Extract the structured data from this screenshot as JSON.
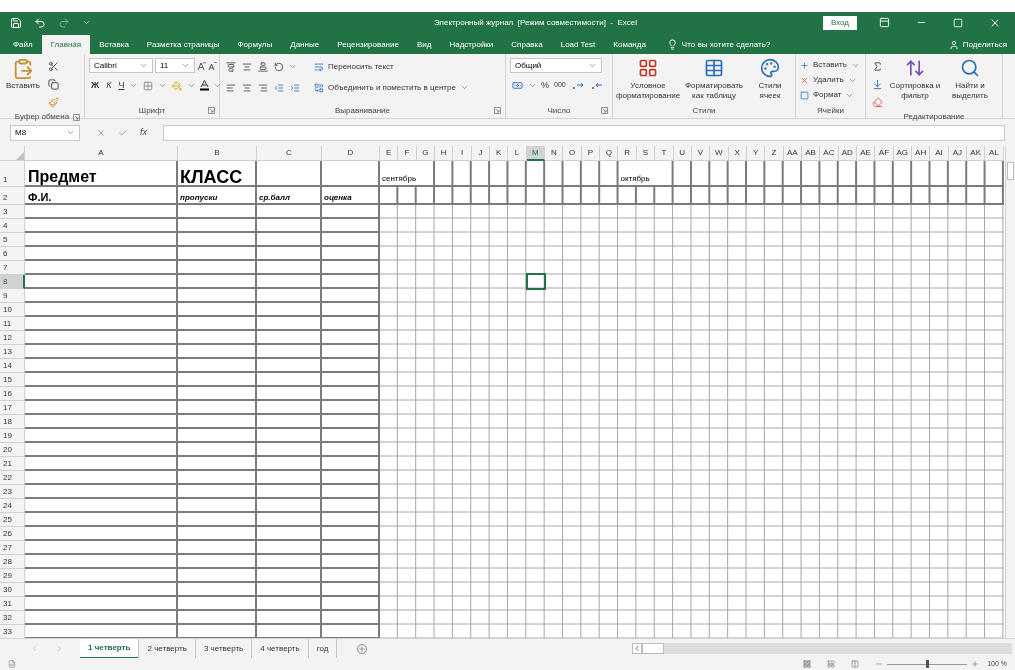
{
  "window": {
    "title": "Электронный журнал  [Режим совместимости]  -  Excel",
    "signin": "Вход"
  },
  "tabs": [
    {
      "label": "Файл",
      "selected": false
    },
    {
      "label": "Главная",
      "selected": true
    },
    {
      "label": "Вставка",
      "selected": false
    },
    {
      "label": "Разметка страницы",
      "selected": false
    },
    {
      "label": "Формулы",
      "selected": false
    },
    {
      "label": "Данные",
      "selected": false
    },
    {
      "label": "Рецензирование",
      "selected": false
    },
    {
      "label": "Вид",
      "selected": false
    },
    {
      "label": "Надстройки",
      "selected": false
    },
    {
      "label": "Справка",
      "selected": false
    },
    {
      "label": "Load Test",
      "selected": false
    },
    {
      "label": "Команда",
      "selected": false
    }
  ],
  "tell_me": {
    "placeholder": "Что вы хотите сделать?"
  },
  "share": "Поделиться",
  "ribbon": {
    "clipboard": {
      "label": "Буфер обмена",
      "paste": "Вставить"
    },
    "font": {
      "label": "Шрифт",
      "family": "Calibri",
      "size": "11",
      "bold": "Ж",
      "italic": "К",
      "underline": "Ч"
    },
    "alignment": {
      "label": "Выравнивание",
      "wrap": "Переносить текст",
      "merge": "Объединить и поместить в центре"
    },
    "number": {
      "label": "Число",
      "format": "Общий",
      "percent": "%",
      "thousands": "000"
    },
    "styles": {
      "label": "Стили",
      "conditional": "Условное форматирование",
      "as_table": "Форматировать как таблицу",
      "cell_styles": "Стили ячеек"
    },
    "cells": {
      "label": "Ячейки",
      "insert": "Вставить",
      "delete": "Удалить",
      "format": "Формат"
    },
    "editing": {
      "label": "Редактирование",
      "sort": "Сортировка и фильтр",
      "find": "Найти и выделить"
    }
  },
  "formula_bar": {
    "name_box": "M8",
    "fx": "fx"
  },
  "sheet": {
    "columns": [
      {
        "label": "A",
        "selected": false
      },
      {
        "label": "B",
        "selected": false
      },
      {
        "label": "C",
        "selected": false
      },
      {
        "label": "D",
        "selected": false
      },
      {
        "label": "E",
        "selected": false
      },
      {
        "label": "F",
        "selected": false
      },
      {
        "label": "G",
        "selected": false
      },
      {
        "label": "H",
        "selected": false
      },
      {
        "label": "I",
        "selected": false
      },
      {
        "label": "J",
        "selected": false
      },
      {
        "label": "K",
        "selected": false
      },
      {
        "label": "L",
        "selected": false
      },
      {
        "label": "M",
        "selected": true
      },
      {
        "label": "N",
        "selected": false
      },
      {
        "label": "O",
        "selected": false
      },
      {
        "label": "P",
        "selected": false
      },
      {
        "label": "Q",
        "selected": false
      },
      {
        "label": "R",
        "selected": false
      },
      {
        "label": "S",
        "selected": false
      },
      {
        "label": "T",
        "selected": false
      },
      {
        "label": "U",
        "selected": false
      },
      {
        "label": "V",
        "selected": false
      },
      {
        "label": "W",
        "selected": false
      },
      {
        "label": "X",
        "selected": false
      },
      {
        "label": "Y",
        "selected": false
      },
      {
        "label": "Z",
        "selected": false
      },
      {
        "label": "AA",
        "selected": false
      },
      {
        "label": "AB",
        "selected": false
      },
      {
        "label": "AC",
        "selected": false
      },
      {
        "label": "AD",
        "selected": false
      },
      {
        "label": "AE",
        "selected": false
      },
      {
        "label": "AF",
        "selected": false
      },
      {
        "label": "AG",
        "selected": false
      },
      {
        "label": "AH",
        "selected": false
      },
      {
        "label": "AI",
        "selected": false
      },
      {
        "label": "AJ",
        "selected": false
      },
      {
        "label": "AK",
        "selected": false
      },
      {
        "label": "AL",
        "selected": false
      }
    ],
    "rows": [
      {
        "label": "1",
        "selected": false
      },
      {
        "label": "2",
        "selected": false
      },
      {
        "label": "3",
        "selected": false
      },
      {
        "label": "4",
        "selected": false
      },
      {
        "label": "5",
        "selected": false
      },
      {
        "label": "6",
        "selected": false
      },
      {
        "label": "7",
        "selected": false
      },
      {
        "label": "8",
        "selected": true
      },
      {
        "label": "9",
        "selected": false
      },
      {
        "label": "10",
        "selected": false
      },
      {
        "label": "11",
        "selected": false
      },
      {
        "label": "12",
        "selected": false
      },
      {
        "label": "13",
        "selected": false
      },
      {
        "label": "14",
        "selected": false
      },
      {
        "label": "15",
        "selected": false
      },
      {
        "label": "16",
        "selected": false
      },
      {
        "label": "17",
        "selected": false
      },
      {
        "label": "18",
        "selected": false
      },
      {
        "label": "19",
        "selected": false
      },
      {
        "label": "20",
        "selected": false
      },
      {
        "label": "21",
        "selected": false
      },
      {
        "label": "22",
        "selected": false
      },
      {
        "label": "23",
        "selected": false
      },
      {
        "label": "24",
        "selected": false
      },
      {
        "label": "25",
        "selected": false
      },
      {
        "label": "26",
        "selected": false
      },
      {
        "label": "27",
        "selected": false
      },
      {
        "label": "28",
        "selected": false
      },
      {
        "label": "29",
        "selected": false
      },
      {
        "label": "30",
        "selected": false
      },
      {
        "label": "31",
        "selected": false
      },
      {
        "label": "32",
        "selected": false
      },
      {
        "label": "33",
        "selected": false
      }
    ],
    "row_1": {
      "subject": "Предмет",
      "class": "КЛАСС",
      "months": [
        "сентябрь",
        "октябрь"
      ]
    },
    "row_2": {
      "name": "Ф.И.",
      "headers": [
        "пропуски",
        "ср.балл",
        "оценка"
      ]
    }
  },
  "sheet_tabs": [
    {
      "label": "1 четверть",
      "selected": true
    },
    {
      "label": "2 четверть",
      "selected": false
    },
    {
      "label": "3 четверть",
      "selected": false
    },
    {
      "label": "4 четверть",
      "selected": false
    },
    {
      "label": "год",
      "selected": false
    }
  ],
  "status_bar": {
    "zoom": "100 %",
    "zoom_slider": {
      "level": 0.5
    }
  }
}
